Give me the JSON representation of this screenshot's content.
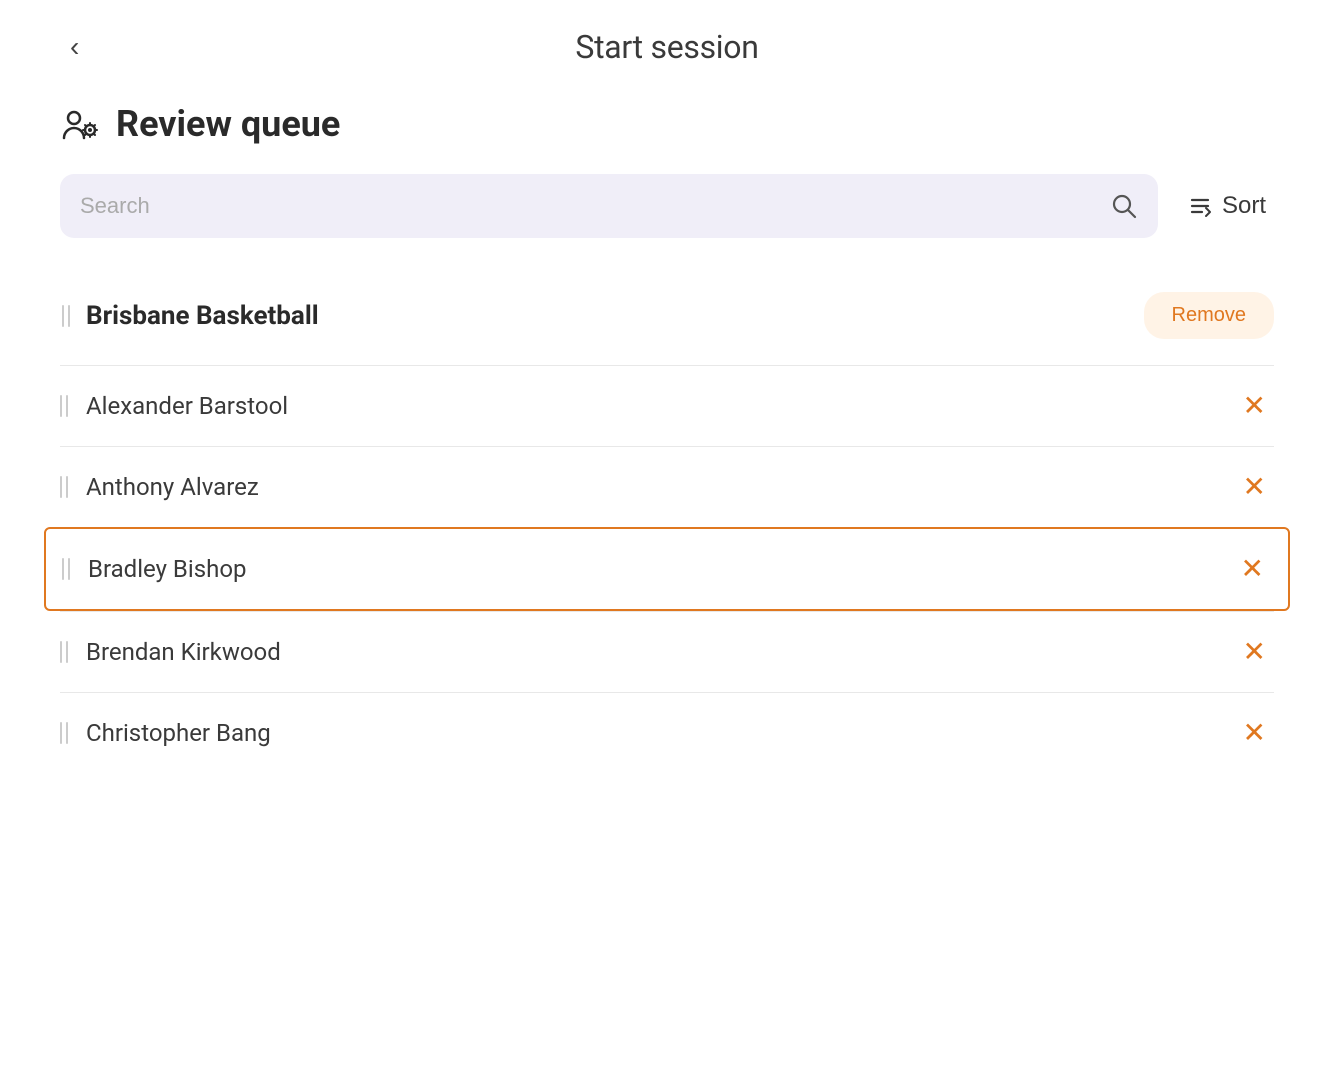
{
  "header": {
    "title": "Start session",
    "back_label": "‹"
  },
  "page": {
    "heading": "Review queue",
    "heading_icon": "review-queue-icon"
  },
  "search": {
    "placeholder": "Search",
    "sort_label": "Sort"
  },
  "group": {
    "name": "Brisbane Basketball",
    "remove_label": "Remove"
  },
  "items": [
    {
      "name": "Alexander Barstool",
      "highlighted": false
    },
    {
      "name": "Anthony Alvarez",
      "highlighted": false
    },
    {
      "name": "Bradley Bishop",
      "highlighted": true
    },
    {
      "name": "Brendan Kirkwood",
      "highlighted": false
    },
    {
      "name": "Christopher Bang",
      "highlighted": false
    }
  ],
  "colors": {
    "accent": "#e07820",
    "accent_bg": "#fff3e6",
    "search_bg": "#f0eef8",
    "highlight_border": "#e07820"
  }
}
